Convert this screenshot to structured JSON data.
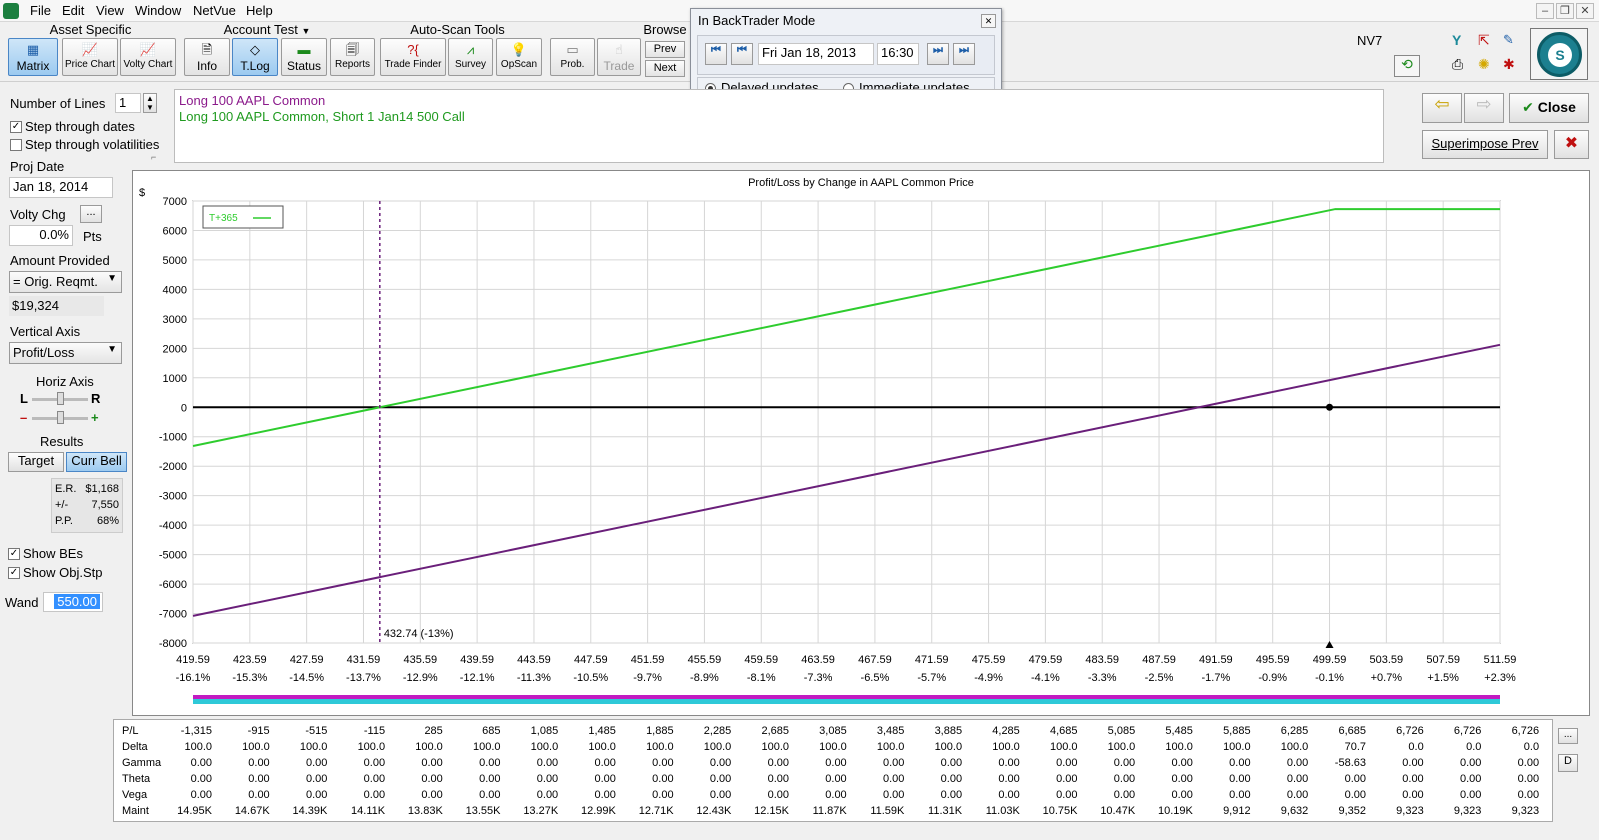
{
  "menu": [
    "File",
    "Edit",
    "View",
    "Window",
    "NetVue",
    "Help"
  ],
  "toolbar": {
    "groups": {
      "asset_specific": "Asset Specific",
      "account_test": "Account Test",
      "auto_scan": "Auto-Scan Tools",
      "browse": "Browse"
    },
    "buttons": {
      "matrix": "Matrix",
      "price_chart": "Price Chart",
      "volty_chart": "Volty Chart",
      "info": "Info",
      "tlog": "T.Log",
      "status": "Status",
      "reports": "Reports",
      "trade_finder": "Trade Finder",
      "survey": "Survey",
      "opscan": "OpScan",
      "prob": "Prob.",
      "trade": "Trade",
      "prev": "Prev",
      "next": "Next"
    },
    "nv_label": "NV7"
  },
  "backtrader": {
    "title": "In BackTrader Mode",
    "date": "Fri Jan 18, 2013",
    "time": "16:30",
    "delayed": "Delayed updates",
    "immediate": "Immediate updates",
    "selected": "delayed"
  },
  "left_panel": {
    "number_of_lines_label": "Number of Lines",
    "number_of_lines": "1",
    "step_dates": "Step through dates",
    "step_dates_checked": true,
    "step_vols": "Step through volatilities",
    "step_vols_checked": false,
    "proj_date_label": "Proj Date",
    "proj_date": "Jan 18, 2014",
    "volty_chg_label": "Volty Chg",
    "volty_chg_btn": "...",
    "volty_chg": "0.0%",
    "volty_unit": "Pts",
    "amount_label": "Amount Provided",
    "amount_combo": "= Orig. Reqmt.",
    "amount": "$19,324",
    "vaxis_label": "Vertical Axis",
    "vaxis_combo": "Profit/Loss",
    "haxis_label": "Horiz Axis",
    "haxis_l": "L",
    "haxis_r": "R",
    "haxis_minus": "–",
    "haxis_plus": "+",
    "results_label": "Results",
    "target": "Target",
    "curr_bell": "Curr Bell",
    "er_label": "E.R.",
    "er": "$1,168",
    "pm_label": "+/-",
    "pm": "7,550",
    "pp_label": "P.P.",
    "pp": "68%",
    "show_bes": "Show BEs",
    "show_objstp": "Show Obj.Stp",
    "wand_label": "Wand",
    "wand": "550.00"
  },
  "strategies": [
    {
      "text": "Long 100 AAPL Common",
      "color": "#8b1a8b"
    },
    {
      "text": "Long 100 AAPL Common, Short 1 Jan14 500 Call",
      "color": "#1f9a1f"
    }
  ],
  "right_buttons": {
    "close": "Close",
    "superimpose": "Superimpose Prev"
  },
  "chart_data": {
    "type": "line",
    "title": "Profit/Loss by Change in AAPL Common Price",
    "ylabel": "$",
    "ylim": [
      -8000,
      7000
    ],
    "yticks": [
      "7000",
      "6000",
      "5000",
      "4000",
      "3000",
      "2000",
      "1000",
      "0",
      "-1000",
      "-2000",
      "-3000",
      "-4000",
      "-5000",
      "-6000",
      "-7000",
      "-8000"
    ],
    "xlim": [
      419.59,
      511.59
    ],
    "xticks": [
      "419.59",
      "423.59",
      "427.59",
      "431.59",
      "435.59",
      "439.59",
      "443.59",
      "447.59",
      "451.59",
      "455.59",
      "459.59",
      "463.59",
      "467.59",
      "471.59",
      "475.59",
      "479.59",
      "483.59",
      "487.59",
      "491.59",
      "495.59",
      "499.59",
      "503.59",
      "507.59",
      "511.59"
    ],
    "xpct": [
      "-16.1%",
      "-15.3%",
      "-14.5%",
      "-13.7%",
      "-12.9%",
      "-12.1%",
      "-11.3%",
      "-10.5%",
      "-9.7%",
      "-8.9%",
      "-8.1%",
      "-7.3%",
      "-6.5%",
      "-5.7%",
      "-4.9%",
      "-4.1%",
      "-3.3%",
      "-2.5%",
      "-1.7%",
      "-0.9%",
      "-0.1%",
      "+0.7%",
      "+1.5%",
      "+2.3%"
    ],
    "legend": "T+365",
    "series": [
      {
        "name": "T+365",
        "color": "#2ecc2e",
        "x": [
          419.59,
          500,
          511.59
        ],
        "y": [
          -1315,
          6726,
          6726
        ]
      },
      {
        "color": "#6a1f7a",
        "x": [
          419.59,
          511.59
        ],
        "y": [
          -7080,
          2120
        ]
      }
    ],
    "be_marker": {
      "x": 432.74,
      "label": "432.74 (-13%)"
    },
    "current_marker": {
      "x": 499.59,
      "y": 0
    }
  },
  "table": {
    "labels": [
      "P/L",
      "Delta",
      "Gamma",
      "Theta",
      "Vega",
      "Maint"
    ],
    "rows": [
      [
        "-1,315",
        "-915",
        "-515",
        "-115",
        "285",
        "685",
        "1,085",
        "1,485",
        "1,885",
        "2,285",
        "2,685",
        "3,085",
        "3,485",
        "3,885",
        "4,285",
        "4,685",
        "5,085",
        "5,485",
        "5,885",
        "6,285",
        "6,685",
        "6,726",
        "6,726",
        "6,726"
      ],
      [
        "100.0",
        "100.0",
        "100.0",
        "100.0",
        "100.0",
        "100.0",
        "100.0",
        "100.0",
        "100.0",
        "100.0",
        "100.0",
        "100.0",
        "100.0",
        "100.0",
        "100.0",
        "100.0",
        "100.0",
        "100.0",
        "100.0",
        "100.0",
        "70.7",
        "0.0",
        "0.0",
        "0.0"
      ],
      [
        "0.00",
        "0.00",
        "0.00",
        "0.00",
        "0.00",
        "0.00",
        "0.00",
        "0.00",
        "0.00",
        "0.00",
        "0.00",
        "0.00",
        "0.00",
        "0.00",
        "0.00",
        "0.00",
        "0.00",
        "0.00",
        "0.00",
        "0.00",
        "-58.63",
        "0.00",
        "0.00",
        "0.00"
      ],
      [
        "0.00",
        "0.00",
        "0.00",
        "0.00",
        "0.00",
        "0.00",
        "0.00",
        "0.00",
        "0.00",
        "0.00",
        "0.00",
        "0.00",
        "0.00",
        "0.00",
        "0.00",
        "0.00",
        "0.00",
        "0.00",
        "0.00",
        "0.00",
        "0.00",
        "0.00",
        "0.00",
        "0.00"
      ],
      [
        "0.00",
        "0.00",
        "0.00",
        "0.00",
        "0.00",
        "0.00",
        "0.00",
        "0.00",
        "0.00",
        "0.00",
        "0.00",
        "0.00",
        "0.00",
        "0.00",
        "0.00",
        "0.00",
        "0.00",
        "0.00",
        "0.00",
        "0.00",
        "0.00",
        "0.00",
        "0.00",
        "0.00"
      ],
      [
        "14.95K",
        "14.67K",
        "14.39K",
        "14.11K",
        "13.83K",
        "13.55K",
        "13.27K",
        "12.99K",
        "12.71K",
        "12.43K",
        "12.15K",
        "11.87K",
        "11.59K",
        "11.31K",
        "11.03K",
        "10.75K",
        "10.47K",
        "10.19K",
        "9,912",
        "9,632",
        "9,352",
        "9,323",
        "9,323",
        "9,323"
      ]
    ],
    "side_btn": "...",
    "side_btn2": "D"
  }
}
